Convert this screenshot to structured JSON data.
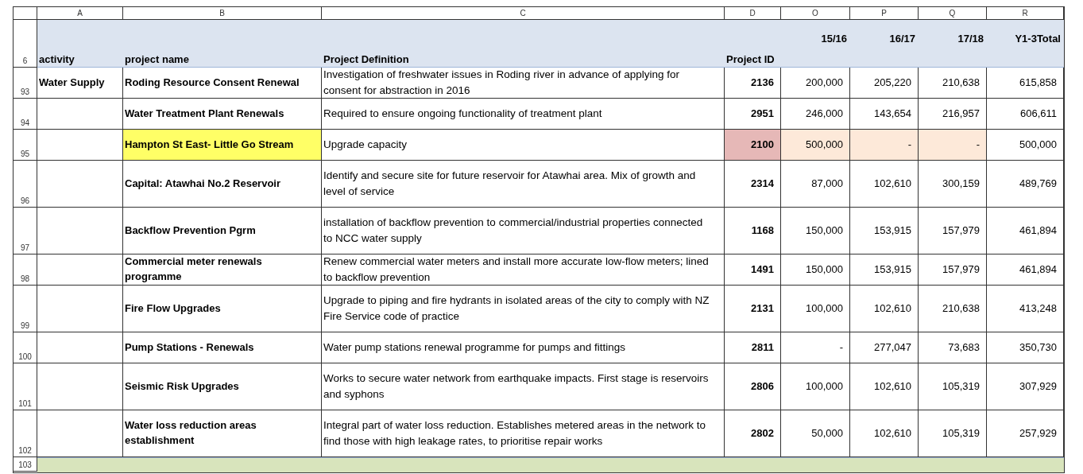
{
  "column_letters": [
    "A",
    "B",
    "C",
    "D",
    "O",
    "P",
    "Q",
    "R"
  ],
  "header": {
    "row": "6",
    "cells": [
      "activity",
      "project name",
      "Project Definition",
      "Project ID",
      "15/16",
      "16/17",
      "17/18",
      "Y1-3Total"
    ]
  },
  "rows": [
    {
      "row": "93",
      "cells": [
        {
          "text": "Water Supply"
        },
        {
          "text": "Roding Resource Consent Renewal"
        },
        {
          "text": "Investigation of freshwater issues in Roding river in advance of applying for consent for abstraction in 2016"
        },
        {
          "text": "2136"
        },
        {
          "text": "200,000"
        },
        {
          "text": "205,220"
        },
        {
          "text": "210,638"
        },
        {
          "text": "615,858"
        }
      ]
    },
    {
      "row": "94",
      "cells": [
        {},
        {
          "text": "Water Treatment Plant Renewals"
        },
        {
          "text": "Required to ensure ongoing functionality of treatment plant"
        },
        {
          "text": "2951"
        },
        {
          "text": "246,000"
        },
        {
          "text": "143,654"
        },
        {
          "text": "216,957"
        },
        {
          "text": "606,611"
        }
      ]
    },
    {
      "row": "95",
      "cells": [
        {},
        {
          "text": "Hampton St East- Little Go Stream",
          "color": "#ffff66"
        },
        {
          "text": "Upgrade capacity"
        },
        {
          "text": "2100",
          "color": "#e6b8b7"
        },
        {
          "text": "500,000",
          "color": "#fde9d9"
        },
        {
          "text": "-",
          "color": "#fde9d9"
        },
        {
          "text": "-",
          "color": "#fde9d9"
        },
        {
          "text": "500,000"
        }
      ]
    },
    {
      "row": "96",
      "cells": [
        {},
        {
          "text": "Capital: Atawhai No.2 Reservoir"
        },
        {
          "text": "Identify and secure site for future reservoir for Atawhai area. Mix of growth and level of service"
        },
        {
          "text": "2314"
        },
        {
          "text": "87,000"
        },
        {
          "text": "102,610"
        },
        {
          "text": "300,159"
        },
        {
          "text": "489,769"
        }
      ]
    },
    {
      "row": "97",
      "cells": [
        {},
        {
          "text": "Backflow Prevention Pgrm"
        },
        {
          "text": "installation of backflow prevention to commercial/industrial properties connected to NCC water supply"
        },
        {
          "text": "1168"
        },
        {
          "text": "150,000"
        },
        {
          "text": "153,915"
        },
        {
          "text": "157,979"
        },
        {
          "text": "461,894"
        }
      ]
    },
    {
      "row": "98",
      "cells": [
        {},
        {
          "text": "Commercial meter renewals programme"
        },
        {
          "text": "Renew commercial water meters and install more accurate low-flow meters; lined to backflow prevention"
        },
        {
          "text": "1491"
        },
        {
          "text": "150,000"
        },
        {
          "text": "153,915"
        },
        {
          "text": "157,979"
        },
        {
          "text": "461,894"
        }
      ]
    },
    {
      "row": "99",
      "cells": [
        {},
        {
          "text": "Fire Flow Upgrades"
        },
        {
          "text": "Upgrade to piping and fire hydrants in isolated areas of the city to comply with NZ Fire Service code of practice"
        },
        {
          "text": "2131"
        },
        {
          "text": "100,000"
        },
        {
          "text": "102,610"
        },
        {
          "text": "210,638"
        },
        {
          "text": "413,248"
        }
      ]
    },
    {
      "row": "100",
      "cells": [
        {},
        {
          "text": "Pump Stations - Renewals"
        },
        {
          "text": "Water pump stations renewal programme for pumps and fittings"
        },
        {
          "text": "2811"
        },
        {
          "text": "-"
        },
        {
          "text": "277,047"
        },
        {
          "text": "73,683"
        },
        {
          "text": "350,730"
        }
      ]
    },
    {
      "row": "101",
      "cells": [
        {},
        {
          "text": "Seismic Risk Upgrades"
        },
        {
          "text": "Works to secure water network from earthquake impacts. First stage is reservoirs and syphons"
        },
        {
          "text": "2806"
        },
        {
          "text": "100,000"
        },
        {
          "text": "102,610"
        },
        {
          "text": "105,319"
        },
        {
          "text": "307,929"
        }
      ]
    },
    {
      "row": "102",
      "cells": [
        {},
        {
          "text": "Water loss reduction areas establishment"
        },
        {
          "text": "Integral part of water loss reduction. Establishes metered areas in the network to find those with high leakage rates, to prioritise repair works"
        },
        {
          "text": "2802"
        },
        {
          "text": "50,000"
        },
        {
          "text": "102,610"
        },
        {
          "text": "105,319"
        },
        {
          "text": "257,929"
        }
      ]
    },
    {
      "row": "103",
      "color": "#d8e4bc"
    }
  ]
}
